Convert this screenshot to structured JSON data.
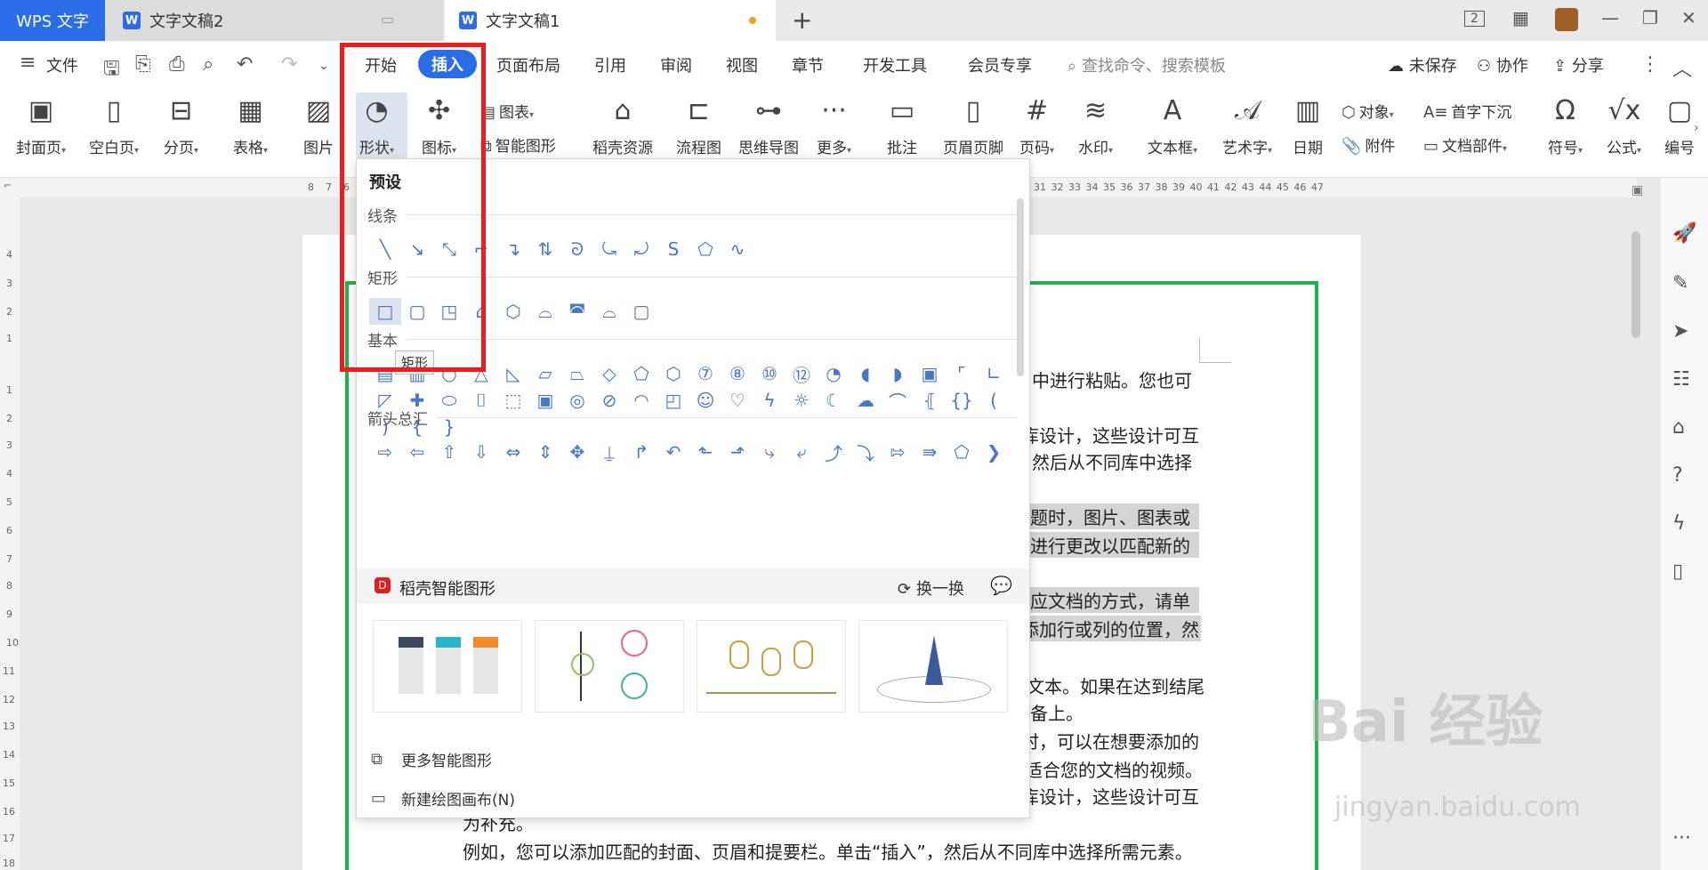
{
  "titlebar": {
    "app_tab": "WPS 文字",
    "tabs": [
      {
        "label": "文字文稿2"
      },
      {
        "label": "文字文稿1"
      }
    ],
    "new_tab": "+",
    "page_count": "2"
  },
  "menubar": {
    "file": "文件",
    "items": [
      "开始",
      "插入",
      "页面布局",
      "引用",
      "审阅",
      "视图",
      "章节",
      "开发工具",
      "会员专享"
    ],
    "search_placeholder": "查找命令、搜索模板",
    "unsaved": "未保存",
    "collab": "协作",
    "share": "分享"
  },
  "ribbon": {
    "buttons": [
      "封面页",
      "空白页",
      "分页",
      "表格",
      "图片",
      "形状",
      "图标",
      "稻壳资源",
      "流程图",
      "思维导图",
      "更多",
      "批注",
      "页眉页脚",
      "页码",
      "水印",
      "文本框",
      "艺术字",
      "日期",
      "符号",
      "公式",
      "编号"
    ],
    "small": {
      "chart": "图表",
      "smart_shape": "智能图形",
      "object": "对象",
      "dropcap": "首字下沉",
      "attachment": "附件",
      "doc_parts": "文档部件"
    }
  },
  "ruler": {
    "left_ticks": [
      "8",
      "7",
      "6"
    ],
    "right_ticks": "31 32 33 34 35 36 37 38 39 40 41 42 43 44 45 46 47",
    "vertical": [
      "4",
      "3",
      "2",
      "1",
      "1",
      "2",
      "3",
      "4",
      "5",
      "6",
      "7",
      "8",
      "9",
      "10",
      "11",
      "12",
      "13",
      "14",
      "15",
      "16",
      "17",
      "18"
    ]
  },
  "panel": {
    "title": "预设",
    "sections": {
      "lines": "线条",
      "rect": "矩形",
      "basic": "基本",
      "arrows": "箭头总汇"
    },
    "tooltip": "矩形",
    "smart_title": "稻壳智能图形",
    "swap": "换一换",
    "more_smart": "更多智能图形",
    "new_canvas": "新建绘图画布(N)"
  },
  "document": {
    "lines": [
      "中进行粘贴。您也可",
      "库设计，这些设计可互",
      "然后从不同库中选择",
      "题时，图片、图表或",
      "进行更改以匹配新的",
      "应文档的方式，请单",
      "添加行或列的位置，然",
      "文本。如果在达到结尾",
      "备上。",
      "时，可以在想要添加的",
      "适合您的文档的视频。",
      "库设计，这些设计可互",
      "为补充。",
      "例如，您可以添加匹配的封面、页眉和提要栏。单击“插入”，然后从不同库中选择所需元素。"
    ]
  },
  "watermark": {
    "brand": "Bai 经验",
    "url": "jingyan.baidu.com"
  },
  "colors": {
    "accent": "#2b6de8",
    "highlight_box": "#f21b1b",
    "page_frame": "#1db34a"
  }
}
